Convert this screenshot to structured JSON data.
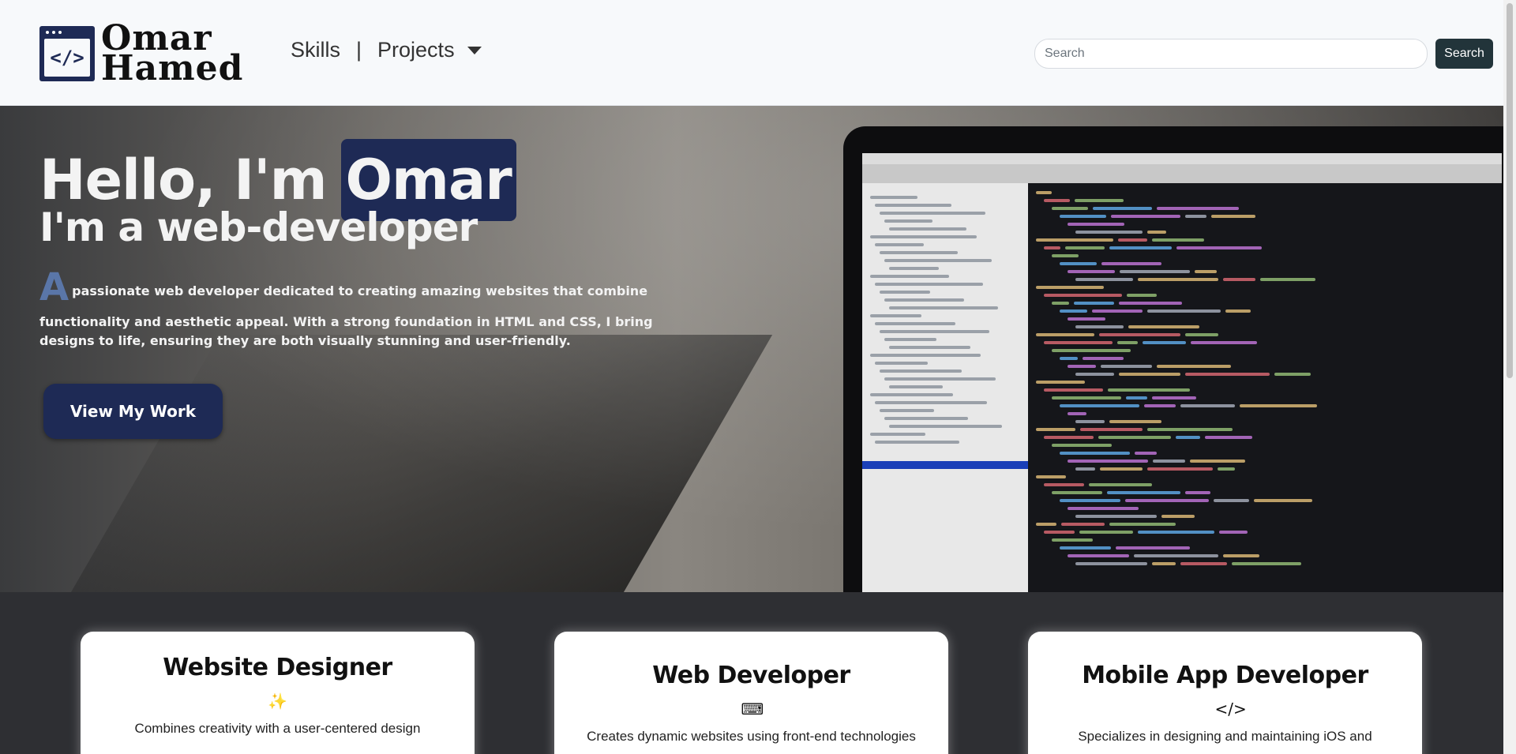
{
  "navbar": {
    "brand_line1": "Omar",
    "brand_line2": "Hamed",
    "brand_code": "</>",
    "links": [
      {
        "label": "Skills"
      },
      {
        "label": "Projects"
      }
    ],
    "separator": "|",
    "search_placeholder": "Search",
    "search_button": "Search"
  },
  "hero": {
    "greeting": "Hello, I'm",
    "name": "Omar",
    "subtitle": "I'm a web-developer",
    "dropcap": "A",
    "desc_first": "passionate web developer dedicated to creating amazing websites that combine",
    "desc_rest": "functionality and aesthetic appeal. With a strong foundation in HTML and CSS, I bring designs to life, ensuring they are both visually stunning and user-friendly.",
    "cta": "View My Work"
  },
  "cards": [
    {
      "title": "Website Designer",
      "icon": "magic-wand-icon",
      "glyph": "✨",
      "text": "Combines creativity with a user-centered design"
    },
    {
      "title": "Web Developer",
      "icon": "laptop-code-icon",
      "glyph": "⌨",
      "text": "Creates dynamic websites using front-end technologies"
    },
    {
      "title": "Mobile App Developer",
      "icon": "code-icon",
      "glyph": "</>",
      "text": "Specializes in designing and maintaining iOS and"
    }
  ],
  "colors": {
    "brand": "#1e2a55",
    "navbar_bg": "#f7f9fb",
    "search_button_bg": "#22343a",
    "section_bg": "#2e2f33",
    "dropcap": "#5a76a8"
  }
}
